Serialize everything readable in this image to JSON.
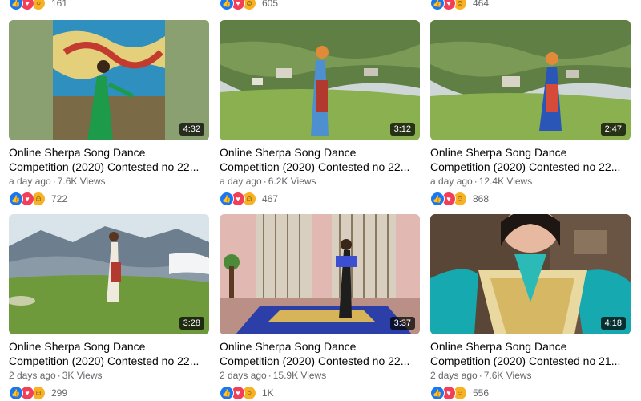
{
  "top_row": [
    {
      "count": "161",
      "reactions": [
        "like-icon",
        "love-icon",
        "wow-icon"
      ]
    },
    {
      "count": "605",
      "reactions": [
        "like-icon",
        "love-icon",
        "haha-icon"
      ]
    },
    {
      "count": "464",
      "reactions": [
        "like-icon",
        "love-icon",
        "haha-icon"
      ]
    }
  ],
  "videos": [
    {
      "title1": "Online Sherpa Song Dance",
      "title2": "Competition (2020) Contested no 22...",
      "age": "a day ago",
      "views": "7.6K Views",
      "duration": "4:32",
      "reactions_count": "722"
    },
    {
      "title1": "Online Sherpa Song Dance",
      "title2": "Competition (2020) Contested no 22...",
      "age": "a day ago",
      "views": "6.2K Views",
      "duration": "3:12",
      "reactions_count": "467"
    },
    {
      "title1": "Online Sherpa Song Dance",
      "title2": "Competition (2020) Contested no 22...",
      "age": "a day ago",
      "views": "12.4K Views",
      "duration": "2:47",
      "reactions_count": "868"
    },
    {
      "title1": "Online Sherpa Song Dance",
      "title2": "Competition (2020) Contested no 22...",
      "age": "2 days ago",
      "views": "3K Views",
      "duration": "3:28",
      "reactions_count": "299"
    },
    {
      "title1": "Online Sherpa Song Dance",
      "title2": "Competition (2020) Contested no 22...",
      "age": "2 days ago",
      "views": "15.9K Views",
      "duration": "3:37",
      "reactions_count": "1K"
    },
    {
      "title1": "Online Sherpa Song Dance",
      "title2": "Competition (2020) Contested no 21...",
      "age": "2 days ago",
      "views": "7.6K Views",
      "duration": "4:18",
      "reactions_count": "556"
    }
  ]
}
